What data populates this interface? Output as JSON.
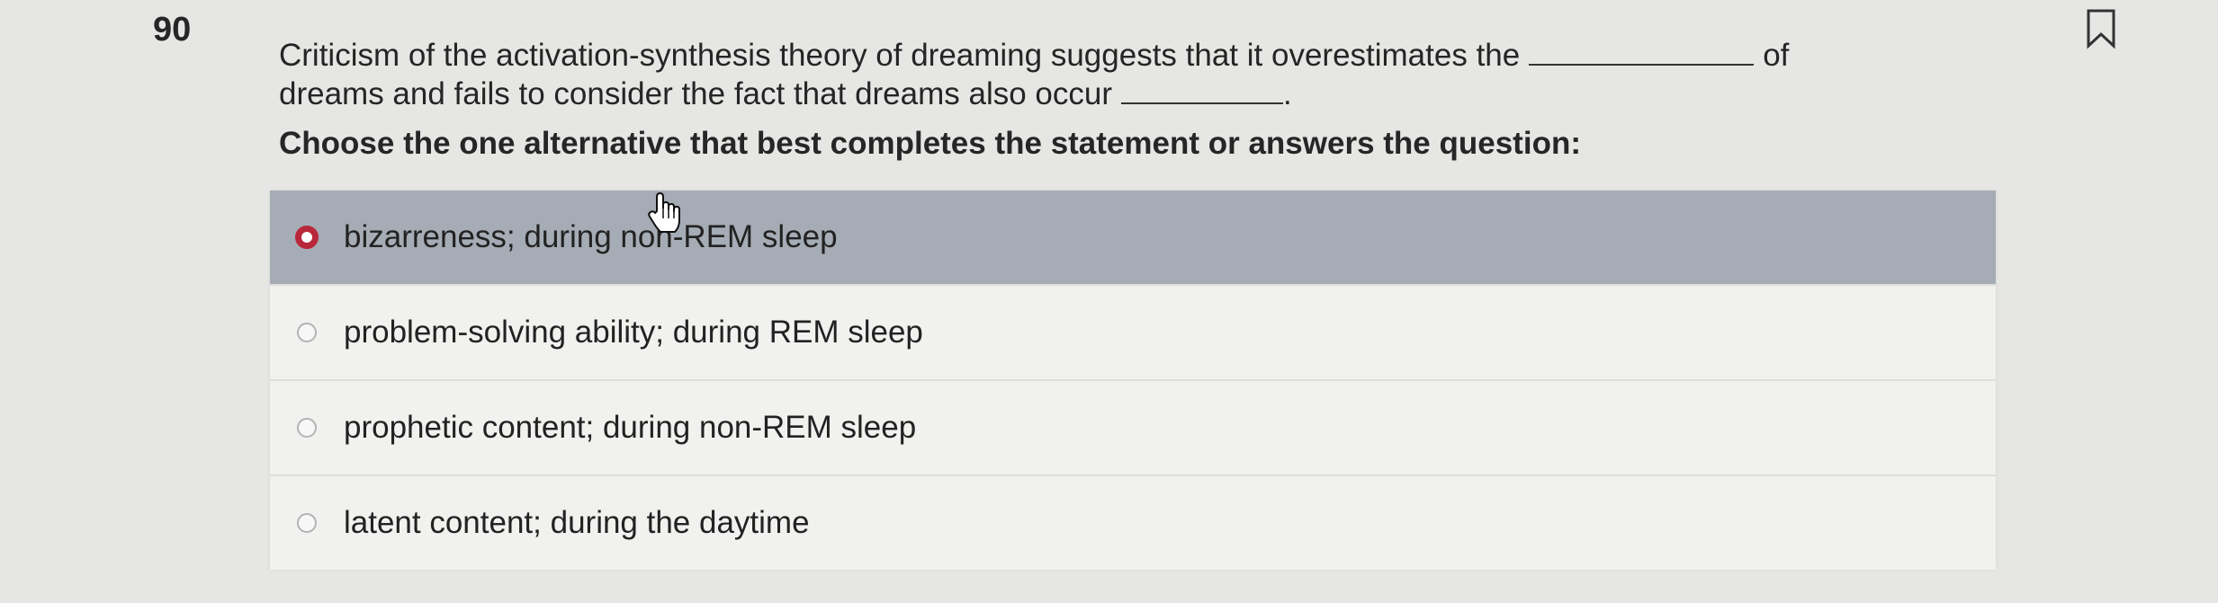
{
  "question": {
    "number": "90",
    "stem_part1": "Criticism of the activation-synthesis theory of dreaming suggests that it overestimates the",
    "stem_part2": "of",
    "stem_part3": "dreams and fails to consider the fact that dreams also occur",
    "stem_part4": ".",
    "instruction": "Choose the one alternative that best completes the statement or answers the question:"
  },
  "options": [
    {
      "label": "bizarreness; during non-REM sleep",
      "selected": true
    },
    {
      "label": "problem-solving ability; during REM sleep",
      "selected": false
    },
    {
      "label": "prophetic content; during non-REM sleep",
      "selected": false
    },
    {
      "label": "latent content; during the daytime",
      "selected": false
    }
  ],
  "icons": {
    "bookmark": "bookmark-icon",
    "cursor": "hand-pointer-icon"
  },
  "colors": {
    "selected_row": "#a6acb5",
    "selected_radio": "#b8283a",
    "page_background": "#e6e6e4",
    "options_background": "#f1f1ef"
  }
}
